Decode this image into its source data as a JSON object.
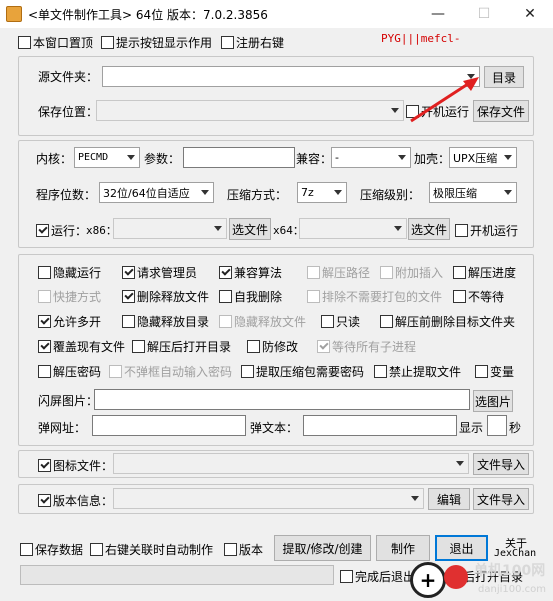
{
  "window": {
    "title": "<单文件制作工具> 64位 版本：7.0.2.3856",
    "minimize": "—",
    "maximize": "☐",
    "close": "✕"
  },
  "top_options": {
    "stay_on_top": "本窗口置顶",
    "show_button_tips": "提示按钮显示作用",
    "register_right_click": "注册右键",
    "tag": "PYG|||mefcl-"
  },
  "source": {
    "source_folder_label": "源文件夹：",
    "dir_button": "目录",
    "save_location_label": "保存位置：",
    "autostart": "开机运行",
    "save_file_button": "保存文件"
  },
  "kernel": {
    "kernel_label": "内核：",
    "kernel_value": "PECMD",
    "params_label": "参数：",
    "compat_label": "兼容：",
    "compat_value": "-",
    "shell_label": "加壳：",
    "shell_value": "UPX压缩",
    "bits_label": "程序位数：",
    "bits_value": "32位/64位自适应",
    "compress_method_label": "压缩方式：",
    "compress_method_value": "7z",
    "compress_level_label": "压缩级别：",
    "compress_level_value": "极限压缩",
    "run_label": "运行：",
    "x86_label": "x86：",
    "select_file_button": "选文件",
    "x64_label": "x64：",
    "select_file_button2": "选文件",
    "autostart": "开机运行"
  },
  "options": {
    "r1": [
      "隐藏运行",
      "请求管理员",
      "兼容算法",
      "解压路径",
      "附加插入",
      "解压进度"
    ],
    "r2": [
      "快捷方式",
      "删除释放文件",
      "自我删除",
      "排除不需要打包的文件",
      "不等待"
    ],
    "r3": [
      "允许多开",
      "隐藏释放目录",
      "隐藏释放文件",
      "只读",
      "解压前删除目标文件夹"
    ],
    "r4": [
      "覆盖现有文件",
      "解压后打开目录",
      "防修改",
      "等待所有子进程"
    ],
    "r5": [
      "解压密码",
      "不弹框自动输入密码",
      "提取压缩包需要密码",
      "禁止提取文件",
      "变量"
    ],
    "splash_label": "闪屏图片：",
    "select_image_button": "选图片",
    "popup_url_label": "弹网址：",
    "popup_text_label": "弹文本：",
    "show_label": "显示",
    "seconds_label": "秒"
  },
  "icon": {
    "icon_file_label": "图标文件：",
    "file_import_button": "文件导入"
  },
  "version": {
    "version_info_label": "版本信息：",
    "edit_button": "编辑",
    "file_import_button": "文件导入"
  },
  "bottom": {
    "save_data": "保存数据",
    "right_click_auto": "右键关联时自动制作",
    "version": "版本",
    "extract_button": "提取/修改/创建",
    "make_button": "制作",
    "exit_button": "退出",
    "about_line1": "关于",
    "about_line2": "JexChan",
    "exit_after_done": "完成后退出",
    "open_dir_after": "后打开目录"
  },
  "watermark": {
    "text": "单机100网",
    "url": "danji100.com"
  },
  "colors": {
    "accent": "#0078d7",
    "arrow": "#e02020",
    "tag": "#d40000",
    "disabled_text": "#a0a0a0"
  }
}
